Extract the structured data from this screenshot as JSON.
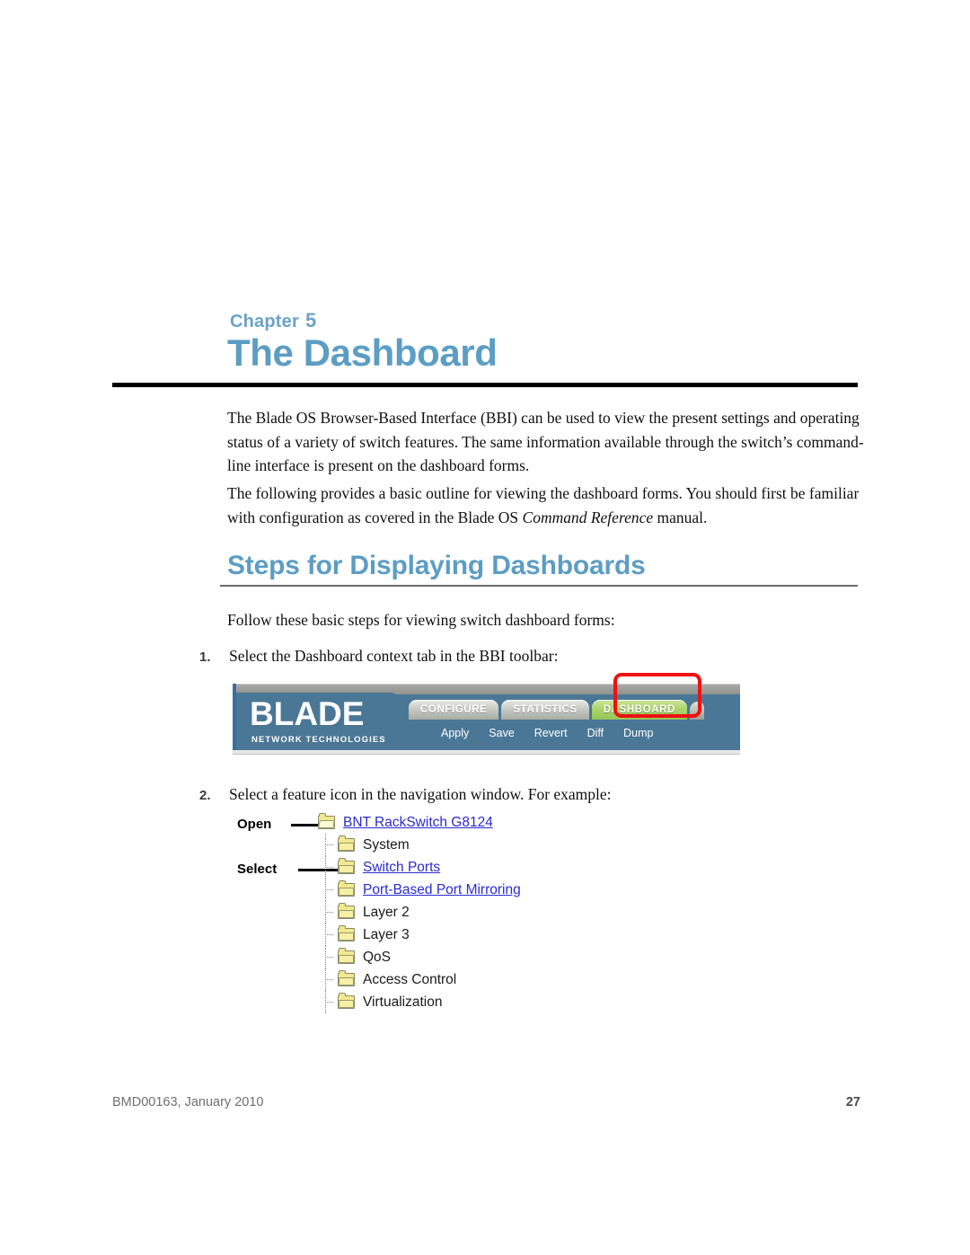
{
  "chapter": {
    "eyebrow_word": "Chapter",
    "number": "5",
    "title": "The Dashboard"
  },
  "paragraphs": {
    "intro_1": "The Blade OS Browser-Based Interface (BBI) can be used to view the present settings and operating status of a variety of switch features. The same information available through the switch’s command-line interface is present on the dashboard forms.",
    "intro_2_a": "The following provides a basic outline for viewing the dashboard forms. You should first be familiar with configuration as covered in the Blade OS ",
    "intro_2_italic": "Command Reference",
    "intro_2_b": " manual.",
    "lead_in": "Follow these basic steps for viewing switch dashboard forms:"
  },
  "section": {
    "title": "Steps for Displaying Dashboards"
  },
  "steps": [
    {
      "marker": "1.",
      "text": "Select the Dashboard context tab in the BBI toolbar:"
    },
    {
      "marker": "2.",
      "text": "Select a feature icon in the navigation window. For example:"
    }
  ],
  "bbi_toolbar": {
    "logo_word": "BLADE",
    "logo_tagline": "NETWORK TECHNOLOGIES",
    "tabs": [
      {
        "label": "CONFIGURE",
        "active": false
      },
      {
        "label": "STATISTICS",
        "active": false
      },
      {
        "label": "DASHBOARD",
        "active": true
      }
    ],
    "actions": [
      "Apply",
      "Save",
      "Revert",
      "Diff",
      "Dump"
    ],
    "highlight_color": "#ef1111",
    "bar_color": "#4a7796",
    "active_tab_color": "#a9d46a"
  },
  "nav_tree": {
    "callouts": {
      "open": "Open",
      "select": "Select"
    },
    "items": [
      {
        "label": "BNT RackSwitch G8124",
        "link": true,
        "root": true,
        "open": true
      },
      {
        "label": "System",
        "link": false,
        "root": false,
        "open": false
      },
      {
        "label": "Switch Ports",
        "link": true,
        "root": false,
        "open": false
      },
      {
        "label": "Port-Based Port Mirroring",
        "link": true,
        "root": false,
        "open": false
      },
      {
        "label": "Layer 2",
        "link": false,
        "root": false,
        "open": false
      },
      {
        "label": "Layer 3",
        "link": false,
        "root": false,
        "open": false
      },
      {
        "label": "QoS",
        "link": false,
        "root": false,
        "open": false
      },
      {
        "label": "Access Control",
        "link": false,
        "root": false,
        "open": false
      },
      {
        "label": "Virtualization",
        "link": false,
        "root": false,
        "open": false
      }
    ]
  },
  "footer": {
    "doc_id": "BMD00163, January 2010",
    "page_number": "27"
  }
}
